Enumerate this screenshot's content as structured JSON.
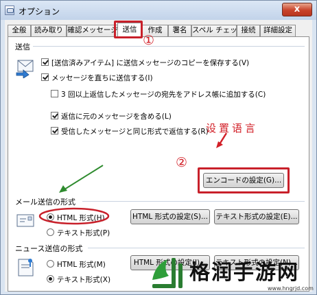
{
  "window": {
    "title": "オプション",
    "close_label": "x"
  },
  "tabs": [
    {
      "label": "全般"
    },
    {
      "label": "読み取り"
    },
    {
      "label": "確認メッセージ"
    },
    {
      "label": "送信"
    },
    {
      "label": "作成"
    },
    {
      "label": "署名"
    },
    {
      "label": "スペル チェック"
    },
    {
      "label": "接続"
    },
    {
      "label": "詳細設定"
    }
  ],
  "active_tab": "送信",
  "send_section": {
    "label": "送信",
    "options": [
      {
        "label": "[送信済みアイテム] に送信メッセージのコピーを保存する(V)",
        "checked": true
      },
      {
        "label": "メッセージを直ちに送信する(I)",
        "checked": true
      },
      {
        "label": "3 回以上返信したメッセージの宛先をアドレス帳に追加する(C)",
        "checked": false
      },
      {
        "label": "返信に元のメッセージを含める(L)",
        "checked": true
      },
      {
        "label": "受信したメッセージと同じ形式で返信する(R)",
        "checked": true
      }
    ],
    "encode_button": "エンコードの設定(G)..."
  },
  "mail_format": {
    "label": "メール送信の形式",
    "options": [
      {
        "label": "HTML 形式(H)",
        "selected": true
      },
      {
        "label": "テキスト形式(P)",
        "selected": false
      }
    ],
    "html_button": "HTML 形式の設定(S)...",
    "text_button": "テキスト形式の設定(E)..."
  },
  "news_format": {
    "label": "ニュース送信の形式",
    "options": [
      {
        "label": "HTML 形式(M)",
        "selected": false
      },
      {
        "label": "テキスト形式(X)",
        "selected": true
      }
    ],
    "html_button": "HTML 形式の設定(I)...",
    "text_button": "テキスト形式の設定(N)..."
  },
  "annotations": {
    "circle_1": "①",
    "circle_2": "②",
    "set_language": "设置语言"
  },
  "watermark": {
    "text": "格润手游网",
    "url": "www.hngrjd.com"
  },
  "colors": {
    "annotation_red": "#d21f27",
    "arrow_green": "#2e8b2e",
    "window_frame": "#7a8ea8"
  }
}
